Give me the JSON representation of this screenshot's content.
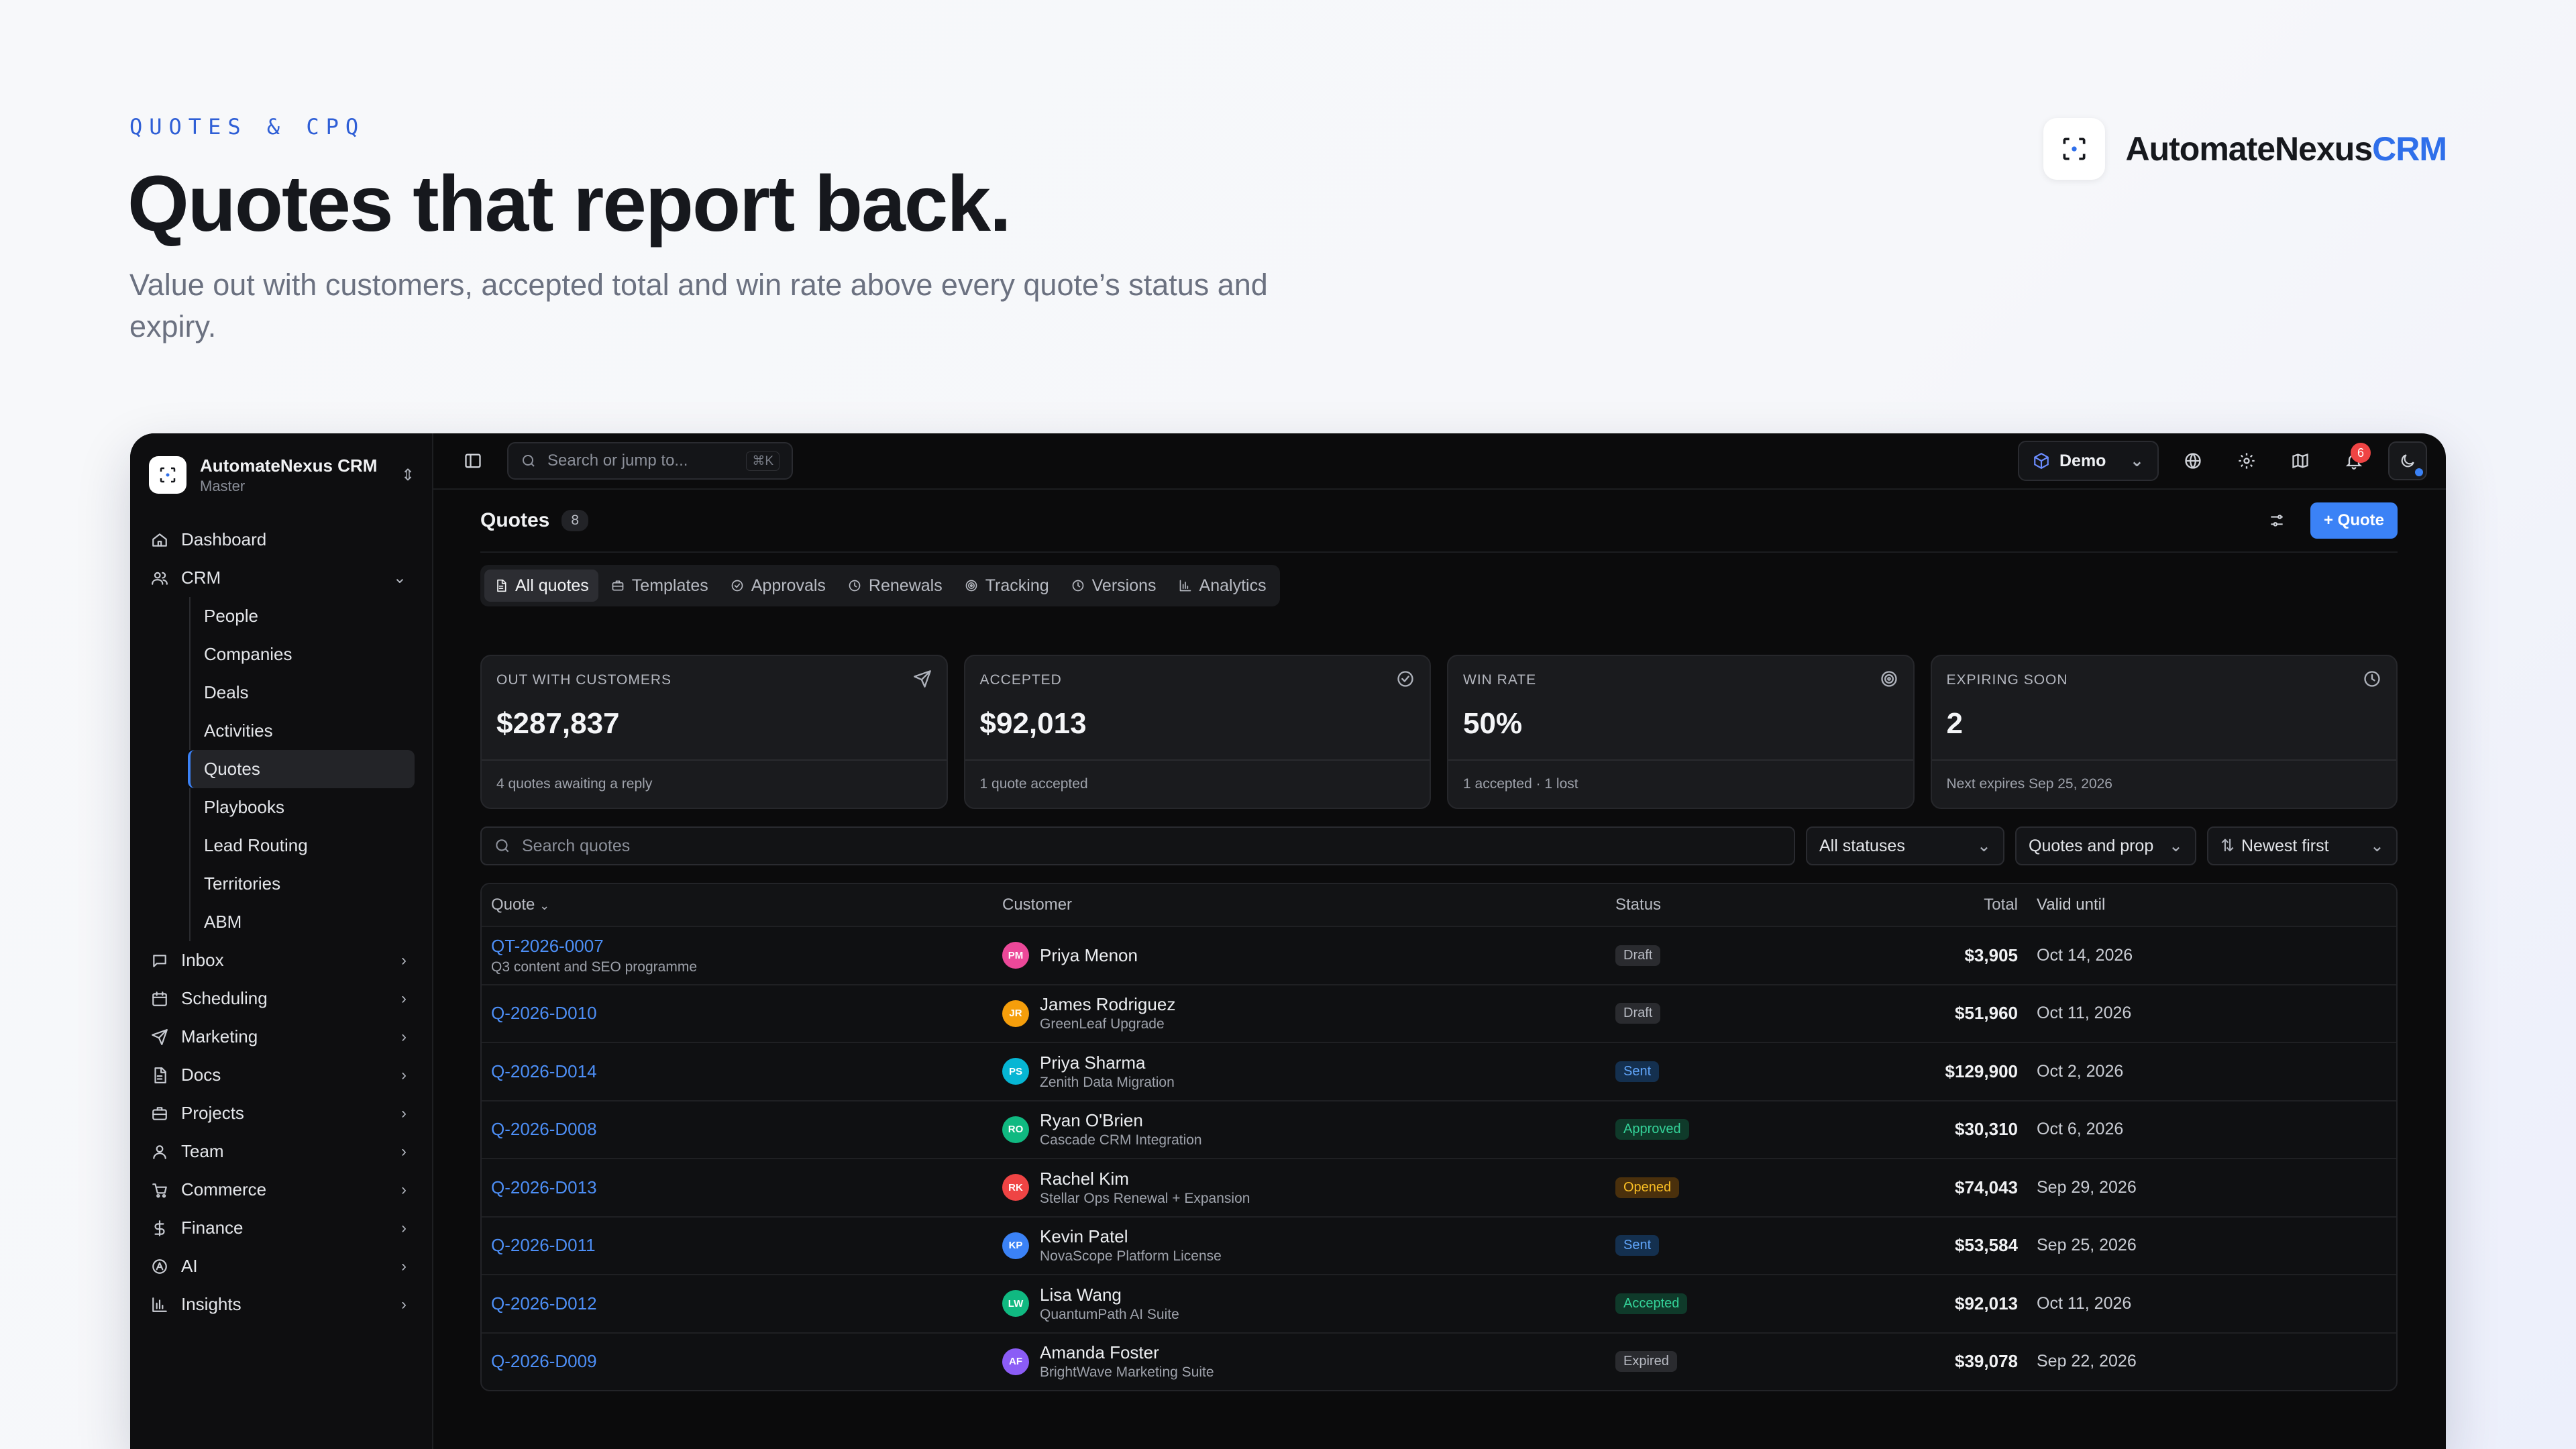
{
  "marketing": {
    "eyebrow": "QUOTES & CPQ",
    "headline": "Quotes that report back.",
    "subline": "Value out with customers, accepted total and win rate above every quote’s status and expiry."
  },
  "brand": {
    "name": "AutomateNexus",
    "suffix": "CRM"
  },
  "workspace": {
    "name": "AutomateNexus CRM",
    "sub": "Master"
  },
  "sidebar": {
    "items": [
      {
        "label": "Dashboard",
        "icon": "home-icon"
      },
      {
        "label": "CRM",
        "icon": "users-icon",
        "expanded": true
      },
      {
        "label": "Inbox",
        "icon": "message-icon"
      },
      {
        "label": "Scheduling",
        "icon": "calendar-icon"
      },
      {
        "label": "Marketing",
        "icon": "send-icon"
      },
      {
        "label": "Docs",
        "icon": "doc-icon"
      },
      {
        "label": "Projects",
        "icon": "briefcase-icon"
      },
      {
        "label": "Team",
        "icon": "user-icon"
      },
      {
        "label": "Commerce",
        "icon": "cart-icon"
      },
      {
        "label": "Finance",
        "icon": "dollar-icon"
      },
      {
        "label": "AI",
        "icon": "ai-icon"
      },
      {
        "label": "Insights",
        "icon": "chart-icon"
      }
    ],
    "crm_sub": [
      "People",
      "Companies",
      "Deals",
      "Activities",
      "Quotes",
      "Playbooks",
      "Lead Routing",
      "Territories",
      "ABM"
    ]
  },
  "topbar": {
    "search_placeholder": "Search or jump to...",
    "search_kbd": "⌘K",
    "workspace_select": "Demo",
    "notifications": "6"
  },
  "page": {
    "title": "Quotes",
    "count": "8",
    "new_button": "+ Quote",
    "tabs": [
      "All quotes",
      "Templates",
      "Approvals",
      "Renewals",
      "Tracking",
      "Versions",
      "Analytics"
    ]
  },
  "kpis": [
    {
      "label": "OUT WITH CUSTOMERS",
      "value": "$287,837",
      "foot": "4 quotes awaiting a reply",
      "icon": "send-icon"
    },
    {
      "label": "ACCEPTED",
      "value": "$92,013",
      "foot": "1 quote accepted",
      "icon": "check-circle-icon"
    },
    {
      "label": "WIN RATE",
      "value": "50%",
      "foot": "1 accepted · 1 lost",
      "icon": "target-icon"
    },
    {
      "label": "EXPIRING SOON",
      "value": "2",
      "foot": "Next expires Sep 25, 2026",
      "icon": "clock-icon"
    }
  ],
  "filters": {
    "search_placeholder": "Search quotes",
    "status": "All statuses",
    "scope": "Quotes and prop",
    "sort": "Newest first"
  },
  "table": {
    "headers": [
      "Quote",
      "Customer",
      "Status",
      "Total",
      "Valid until"
    ],
    "rows": [
      {
        "id": "QT-2026-0007",
        "sub": "Q3 content and SEO programme",
        "initials": "PM",
        "avatar": "#ec4899",
        "customer": "Priya Menon",
        "deal": "",
        "status": "Draft",
        "total": "$3,905",
        "valid": "Oct 14, 2026"
      },
      {
        "id": "Q-2026-D010",
        "sub": "",
        "initials": "JR",
        "avatar": "#f59e0b",
        "customer": "James Rodriguez",
        "deal": "GreenLeaf Upgrade",
        "status": "Draft",
        "total": "$51,960",
        "valid": "Oct 11, 2026"
      },
      {
        "id": "Q-2026-D014",
        "sub": "",
        "initials": "PS",
        "avatar": "#06b6d4",
        "customer": "Priya Sharma",
        "deal": "Zenith Data Migration",
        "status": "Sent",
        "total": "$129,900",
        "valid": "Oct 2, 2026"
      },
      {
        "id": "Q-2026-D008",
        "sub": "",
        "initials": "RO",
        "avatar": "#10b981",
        "customer": "Ryan O'Brien",
        "deal": "Cascade CRM Integration",
        "status": "Approved",
        "total": "$30,310",
        "valid": "Oct 6, 2026"
      },
      {
        "id": "Q-2026-D013",
        "sub": "",
        "initials": "RK",
        "avatar": "#ef4444",
        "customer": "Rachel Kim",
        "deal": "Stellar Ops Renewal + Expansion",
        "status": "Opened",
        "total": "$74,043",
        "valid": "Sep 29, 2026"
      },
      {
        "id": "Q-2026-D011",
        "sub": "",
        "initials": "KP",
        "avatar": "#3b82f6",
        "customer": "Kevin Patel",
        "deal": "NovaScope Platform License",
        "status": "Sent",
        "total": "$53,584",
        "valid": "Sep 25, 2026"
      },
      {
        "id": "Q-2026-D012",
        "sub": "",
        "initials": "LW",
        "avatar": "#10b981",
        "customer": "Lisa Wang",
        "deal": "QuantumPath AI Suite",
        "status": "Accepted",
        "total": "$92,013",
        "valid": "Oct 11, 2026"
      },
      {
        "id": "Q-2026-D009",
        "sub": "",
        "initials": "AF",
        "avatar": "#8b5cf6",
        "customer": "Amanda Foster",
        "deal": "BrightWave Marketing Suite",
        "status": "Expired",
        "total": "$39,078",
        "valid": "Sep 22, 2026"
      }
    ]
  },
  "colors": {
    "accent": "#3b82f6",
    "status": {
      "Draft": {
        "bg": "#2a2b2f",
        "fg": "#b7bac2"
      },
      "Sent": {
        "bg": "#14304f",
        "fg": "#60a5fa"
      },
      "Approved": {
        "bg": "#0f3a2a",
        "fg": "#34d399"
      },
      "Opened": {
        "bg": "#4a300c",
        "fg": "#fbbf24"
      },
      "Accepted": {
        "bg": "#0f3a2a",
        "fg": "#34d399"
      },
      "Expired": {
        "bg": "#2a2b2f",
        "fg": "#b7bac2"
      }
    }
  }
}
